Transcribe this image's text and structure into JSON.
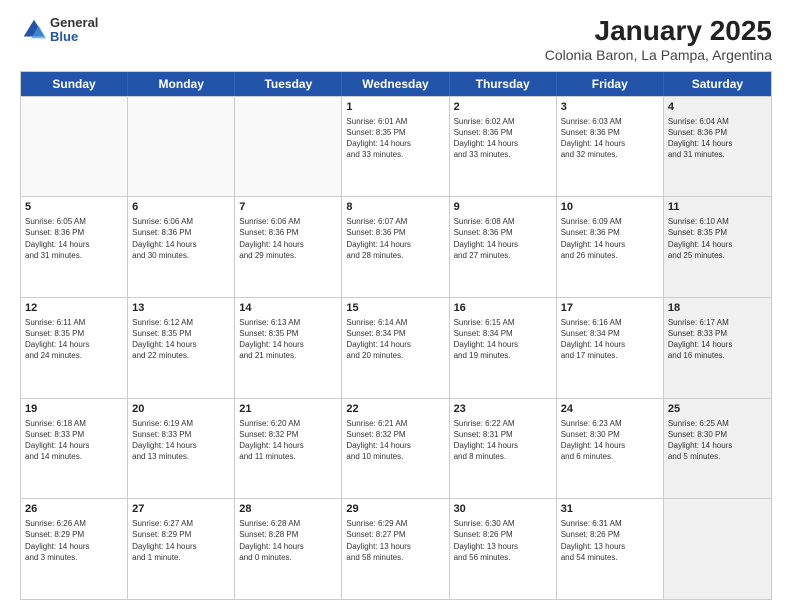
{
  "logo": {
    "general": "General",
    "blue": "Blue"
  },
  "title": "January 2025",
  "subtitle": "Colonia Baron, La Pampa, Argentina",
  "days": [
    "Sunday",
    "Monday",
    "Tuesday",
    "Wednesday",
    "Thursday",
    "Friday",
    "Saturday"
  ],
  "weeks": [
    [
      {
        "num": "",
        "info": "",
        "empty": true
      },
      {
        "num": "",
        "info": "",
        "empty": true
      },
      {
        "num": "",
        "info": "",
        "empty": true
      },
      {
        "num": "1",
        "info": "Sunrise: 6:01 AM\nSunset: 8:35 PM\nDaylight: 14 hours\nand 33 minutes."
      },
      {
        "num": "2",
        "info": "Sunrise: 6:02 AM\nSunset: 8:36 PM\nDaylight: 14 hours\nand 33 minutes."
      },
      {
        "num": "3",
        "info": "Sunrise: 6:03 AM\nSunset: 8:36 PM\nDaylight: 14 hours\nand 32 minutes."
      },
      {
        "num": "4",
        "info": "Sunrise: 6:04 AM\nSunset: 8:36 PM\nDaylight: 14 hours\nand 31 minutes.",
        "shaded": true
      }
    ],
    [
      {
        "num": "5",
        "info": "Sunrise: 6:05 AM\nSunset: 8:36 PM\nDaylight: 14 hours\nand 31 minutes."
      },
      {
        "num": "6",
        "info": "Sunrise: 6:06 AM\nSunset: 8:36 PM\nDaylight: 14 hours\nand 30 minutes."
      },
      {
        "num": "7",
        "info": "Sunrise: 6:06 AM\nSunset: 8:36 PM\nDaylight: 14 hours\nand 29 minutes."
      },
      {
        "num": "8",
        "info": "Sunrise: 6:07 AM\nSunset: 8:36 PM\nDaylight: 14 hours\nand 28 minutes."
      },
      {
        "num": "9",
        "info": "Sunrise: 6:08 AM\nSunset: 8:36 PM\nDaylight: 14 hours\nand 27 minutes."
      },
      {
        "num": "10",
        "info": "Sunrise: 6:09 AM\nSunset: 8:36 PM\nDaylight: 14 hours\nand 26 minutes."
      },
      {
        "num": "11",
        "info": "Sunrise: 6:10 AM\nSunset: 8:35 PM\nDaylight: 14 hours\nand 25 minutes.",
        "shaded": true
      }
    ],
    [
      {
        "num": "12",
        "info": "Sunrise: 6:11 AM\nSunset: 8:35 PM\nDaylight: 14 hours\nand 24 minutes."
      },
      {
        "num": "13",
        "info": "Sunrise: 6:12 AM\nSunset: 8:35 PM\nDaylight: 14 hours\nand 22 minutes."
      },
      {
        "num": "14",
        "info": "Sunrise: 6:13 AM\nSunset: 8:35 PM\nDaylight: 14 hours\nand 21 minutes."
      },
      {
        "num": "15",
        "info": "Sunrise: 6:14 AM\nSunset: 8:34 PM\nDaylight: 14 hours\nand 20 minutes."
      },
      {
        "num": "16",
        "info": "Sunrise: 6:15 AM\nSunset: 8:34 PM\nDaylight: 14 hours\nand 19 minutes."
      },
      {
        "num": "17",
        "info": "Sunrise: 6:16 AM\nSunset: 8:34 PM\nDaylight: 14 hours\nand 17 minutes."
      },
      {
        "num": "18",
        "info": "Sunrise: 6:17 AM\nSunset: 8:33 PM\nDaylight: 14 hours\nand 16 minutes.",
        "shaded": true
      }
    ],
    [
      {
        "num": "19",
        "info": "Sunrise: 6:18 AM\nSunset: 8:33 PM\nDaylight: 14 hours\nand 14 minutes."
      },
      {
        "num": "20",
        "info": "Sunrise: 6:19 AM\nSunset: 8:33 PM\nDaylight: 14 hours\nand 13 minutes."
      },
      {
        "num": "21",
        "info": "Sunrise: 6:20 AM\nSunset: 8:32 PM\nDaylight: 14 hours\nand 11 minutes."
      },
      {
        "num": "22",
        "info": "Sunrise: 6:21 AM\nSunset: 8:32 PM\nDaylight: 14 hours\nand 10 minutes."
      },
      {
        "num": "23",
        "info": "Sunrise: 6:22 AM\nSunset: 8:31 PM\nDaylight: 14 hours\nand 8 minutes."
      },
      {
        "num": "24",
        "info": "Sunrise: 6:23 AM\nSunset: 8:30 PM\nDaylight: 14 hours\nand 6 minutes."
      },
      {
        "num": "25",
        "info": "Sunrise: 6:25 AM\nSunset: 8:30 PM\nDaylight: 14 hours\nand 5 minutes.",
        "shaded": true
      }
    ],
    [
      {
        "num": "26",
        "info": "Sunrise: 6:26 AM\nSunset: 8:29 PM\nDaylight: 14 hours\nand 3 minutes."
      },
      {
        "num": "27",
        "info": "Sunrise: 6:27 AM\nSunset: 8:29 PM\nDaylight: 14 hours\nand 1 minute."
      },
      {
        "num": "28",
        "info": "Sunrise: 6:28 AM\nSunset: 8:28 PM\nDaylight: 14 hours\nand 0 minutes."
      },
      {
        "num": "29",
        "info": "Sunrise: 6:29 AM\nSunset: 8:27 PM\nDaylight: 13 hours\nand 58 minutes."
      },
      {
        "num": "30",
        "info": "Sunrise: 6:30 AM\nSunset: 8:26 PM\nDaylight: 13 hours\nand 56 minutes."
      },
      {
        "num": "31",
        "info": "Sunrise: 6:31 AM\nSunset: 8:26 PM\nDaylight: 13 hours\nand 54 minutes."
      },
      {
        "num": "",
        "info": "",
        "empty": true,
        "shaded": true
      }
    ]
  ]
}
